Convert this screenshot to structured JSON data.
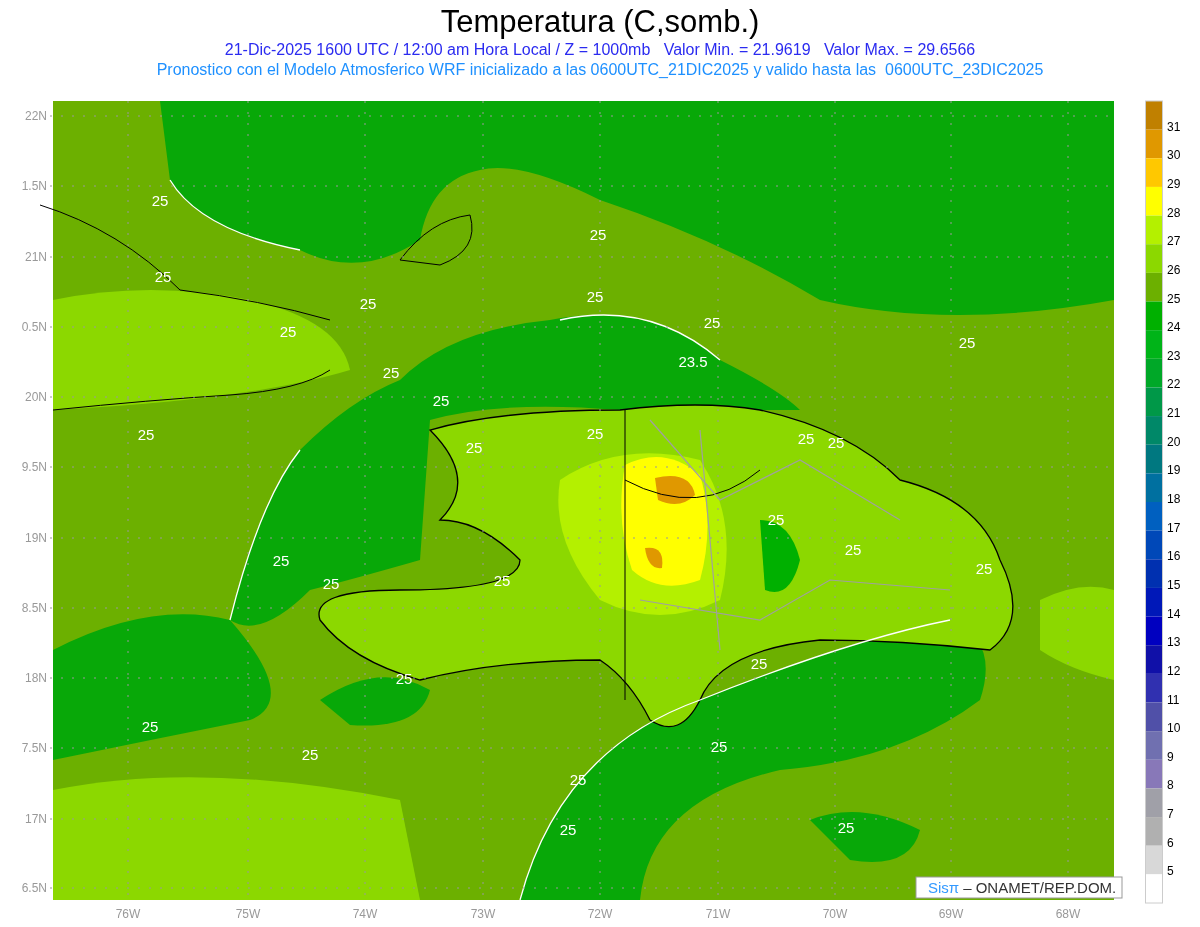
{
  "title": "Temperatura (C,somb.)",
  "subtitle": "21-Dic-2025 1600 UTC / 12:00 am Hora Local / Z = 1000mb   Valor Min. = 21.9619   Valor Max. = 29.6566",
  "model_line": "Pronostico con el Modelo Atmosferico WRF inicializado a las 0600UTC_21DIC2025 y valido hasta las  0600UTC_23DIC2025",
  "lat_labels": [
    "22N",
    "1.5N",
    "21N",
    "0.5N",
    "20N",
    "9.5N",
    "19N",
    "8.5N",
    "18N",
    "7.5N",
    "17N",
    "6.5N"
  ],
  "lon_labels": [
    "76W",
    "75W",
    "74W",
    "73W",
    "72W",
    "71W",
    "70W",
    "69W",
    "68W"
  ],
  "contour_labels": [
    "25",
    "25",
    "25",
    "25",
    "25",
    "25",
    "25",
    "23.5",
    "25",
    "25",
    "25",
    "25",
    "25",
    "25",
    "25",
    "25",
    "25",
    "25",
    "25",
    "25",
    "25",
    "25",
    "25",
    "25",
    "25",
    "25",
    "25",
    "25",
    "25",
    "25"
  ],
  "credit": {
    "logo": "Sisπ",
    "text": "– ONAMET/REP.DOM."
  },
  "colorbar": {
    "segments": [
      {
        "color": "#c08000"
      },
      {
        "color": "#e09800"
      },
      {
        "color": "#ffc800"
      },
      {
        "color": "#ffff00"
      },
      {
        "color": "#b4f000"
      },
      {
        "color": "#8cd800"
      },
      {
        "color": "#6cb000"
      },
      {
        "color": "#00b000"
      },
      {
        "color": "#00b418"
      },
      {
        "color": "#00a828"
      },
      {
        "color": "#009848"
      },
      {
        "color": "#008868"
      },
      {
        "color": "#007880"
      },
      {
        "color": "#0070a0"
      },
      {
        "color": "#0060c0"
      },
      {
        "color": "#0048b8"
      },
      {
        "color": "#0030b0"
      },
      {
        "color": "#0018b8"
      },
      {
        "color": "#0000c0"
      },
      {
        "color": "#1010a8"
      },
      {
        "color": "#3030b0"
      },
      {
        "color": "#5050a8"
      },
      {
        "color": "#7070b0"
      },
      {
        "color": "#8878b8"
      },
      {
        "color": "#a0a0a8"
      },
      {
        "color": "#b0b0b0"
      },
      {
        "color": "#d8d8d8"
      },
      {
        "color": "#ffffff"
      }
    ],
    "labels": [
      "31",
      "30",
      "29",
      "28",
      "27",
      "26",
      "25",
      "24",
      "23",
      "22",
      "21",
      "20",
      "19",
      "18",
      "17",
      "16",
      "15",
      "14",
      "13",
      "12",
      "11",
      "10",
      "9",
      "8",
      "7",
      "6",
      "5"
    ]
  }
}
